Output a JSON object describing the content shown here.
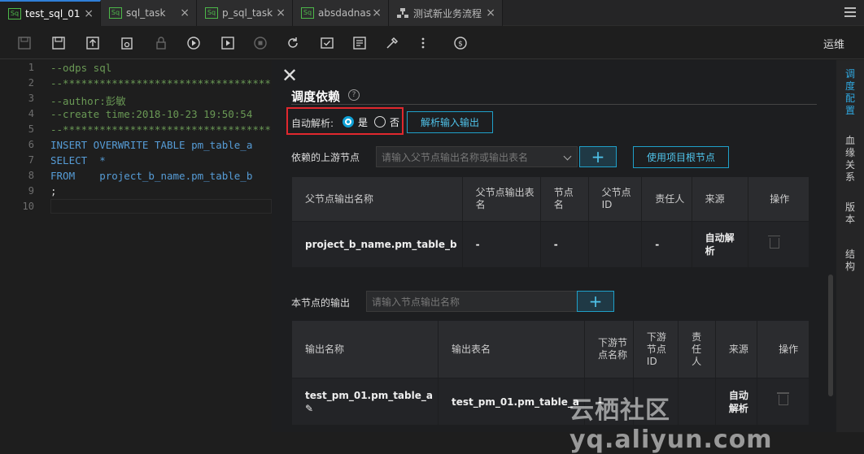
{
  "tabs": [
    {
      "badge": "Sq",
      "label": "test_sql_01",
      "active": true
    },
    {
      "badge": "Sq",
      "label": "sql_task"
    },
    {
      "badge": "Sq",
      "label": "p_sql_task"
    },
    {
      "badge": "Sq",
      "label": "absdadnas"
    },
    {
      "label": "测试新业务流程"
    }
  ],
  "toolbar": {
    "ops_label": "运维"
  },
  "editor": {
    "line_numbers": [
      "1",
      "2",
      "3",
      "4",
      "5",
      "6",
      "7",
      "8",
      "9",
      "10"
    ],
    "lines": [
      "--odps sql",
      "--**********************************",
      "--author:彭敏",
      "--create time:2018-10-23 19:50:54",
      "--**********************************",
      "INSERT OVERWRITE TABLE pm_table_a",
      "SELECT  *",
      "FROM    project_b_name.pm_table_b",
      ";",
      ""
    ]
  },
  "panel": {
    "title": "调度依赖",
    "auto_parse_label": "自动解析:",
    "yes_label": "是",
    "no_label": "否",
    "parse_button": "解析输入输出",
    "upstream_label": "依赖的上游节点",
    "upstream_placeholder": "请输入父节点输出名称或输出表名",
    "plus": "+",
    "root_button": "使用项目根节点",
    "upstream_table": {
      "headers": [
        "父节点输出名称",
        "父节点输出表名",
        "节点名",
        "父节点ID",
        "责任人",
        "来源",
        "操作"
      ],
      "row": [
        "project_b_name.pm_table_b",
        "-",
        "-",
        "",
        "-",
        "自动解析"
      ]
    },
    "output_label": "本节点的输出",
    "output_placeholder": "请输入节点输出名称",
    "output_table": {
      "headers": [
        "输出名称",
        "输出表名",
        "下游节点名称",
        "下游节点ID",
        "责任人",
        "来源",
        "操作"
      ],
      "row": [
        "test_pm_01.pm_table_a",
        "test_pm_01.pm_table_a",
        "-",
        "",
        "",
        "自动解析"
      ]
    }
  },
  "rail": [
    {
      "label": "调度配置",
      "active": true
    },
    {
      "label": "血缘关系"
    },
    {
      "label": "版本"
    },
    {
      "label": "结构"
    }
  ],
  "watermark": "云栖社区 yq.aliyun.com",
  "colors": {
    "accent": "#0fa1d6",
    "highlight_box": "#e0282e",
    "sql_badge": "#4db849"
  }
}
